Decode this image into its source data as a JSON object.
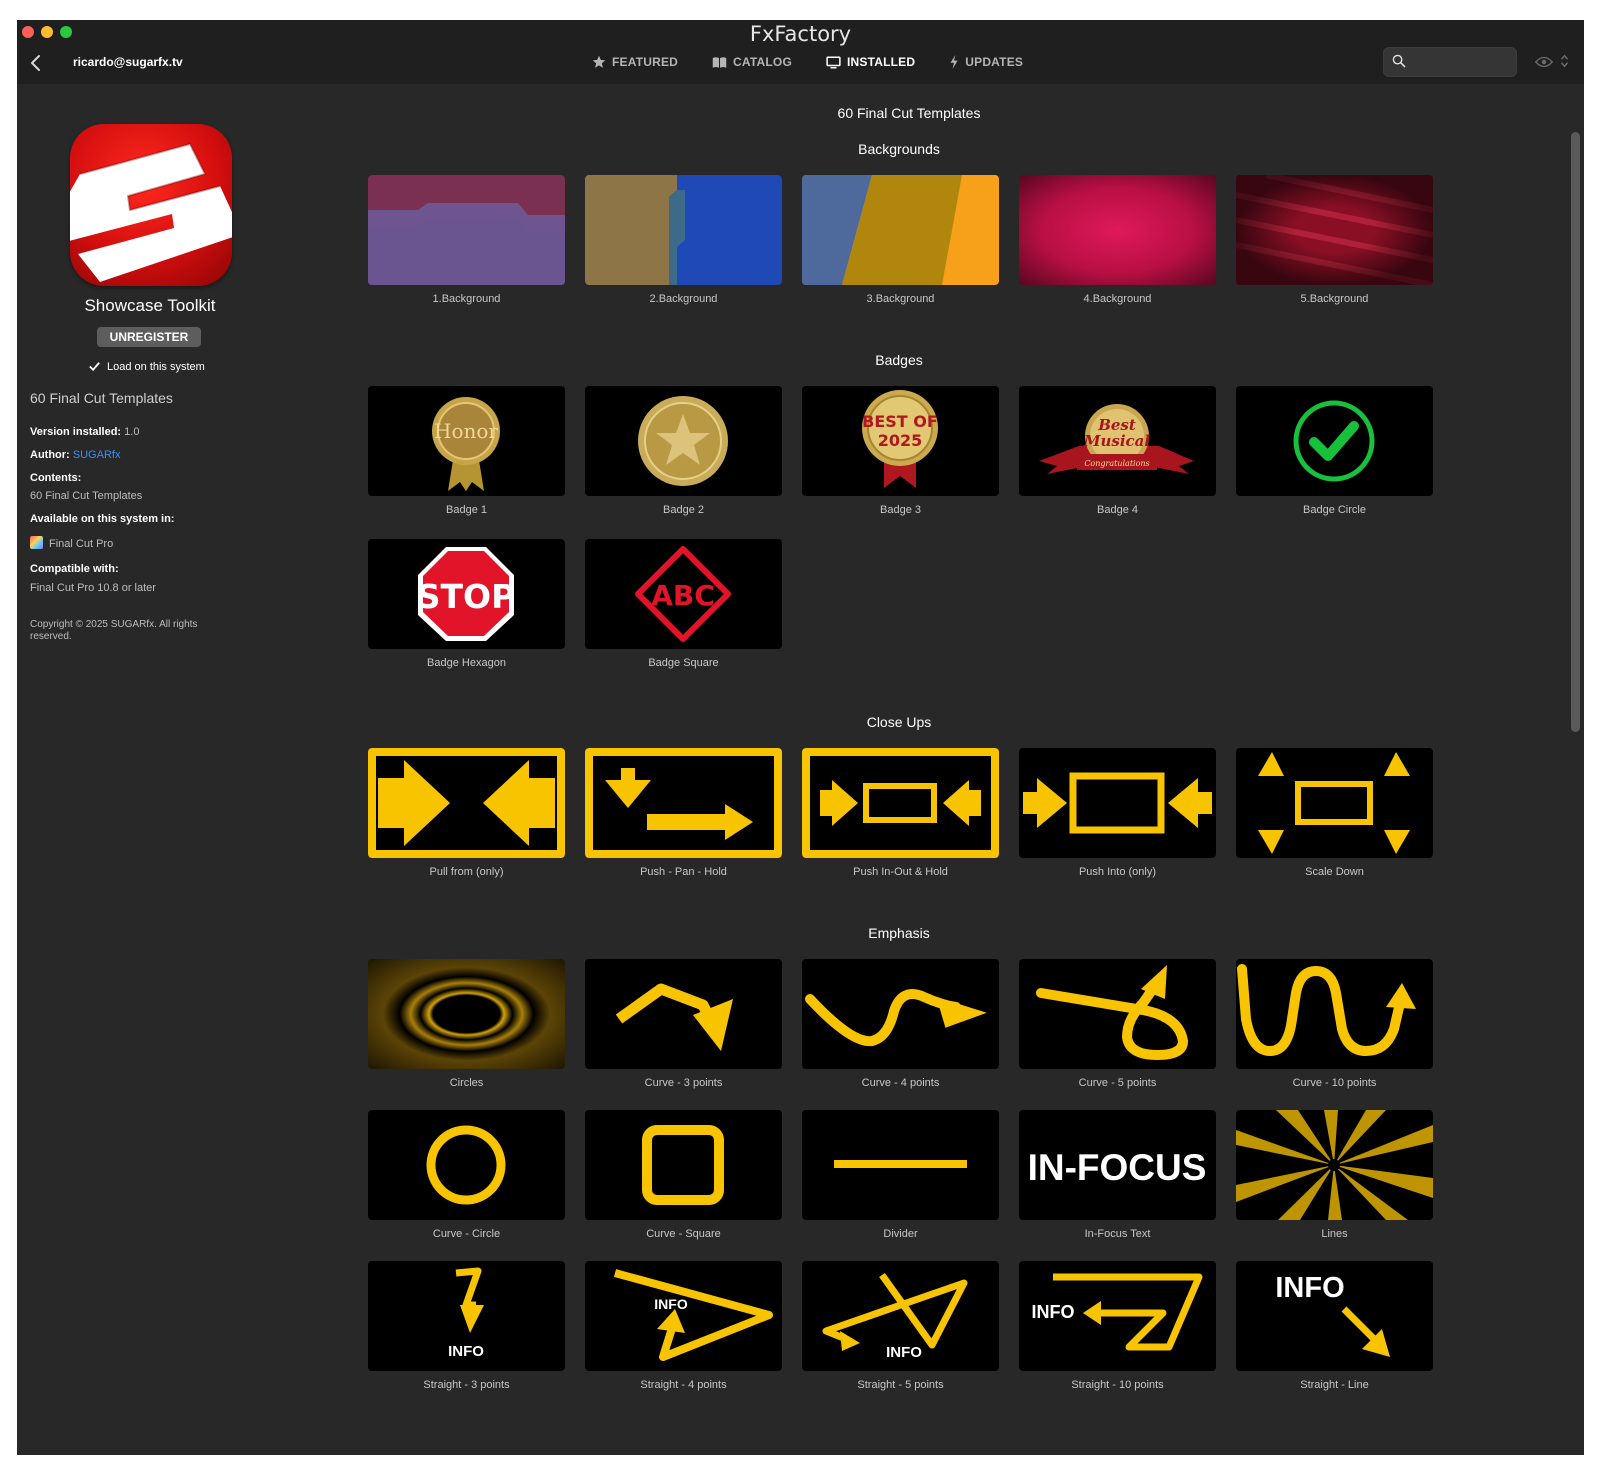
{
  "window": {
    "title": "FxFactory"
  },
  "header": {
    "account": "ricardo@sugarfx.tv",
    "tabs": [
      {
        "label": "FEATURED",
        "icon": "star-icon"
      },
      {
        "label": "CATALOG",
        "icon": "book-icon"
      },
      {
        "label": "INSTALLED",
        "icon": "monitor-icon",
        "active": true
      },
      {
        "label": "UPDATES",
        "icon": "bolt-icon"
      }
    ],
    "search": {
      "placeholder": "",
      "value": ""
    }
  },
  "sidebar": {
    "product_name": "Showcase Toolkit",
    "unregister_label": "UNREGISTER",
    "load_label": "Load on this system",
    "load_checked": true,
    "count": "60 Final Cut Templates",
    "version_label": "Version installed:",
    "version_value": "1.0",
    "author_label": "Author:",
    "author_value": "SUGARfx",
    "contents_label": "Contents:",
    "contents_value": "60 Final Cut Templates",
    "available_label": "Available on this system in:",
    "available_value": "Final Cut Pro",
    "compatible_label": "Compatible with:",
    "compatible_value": "Final Cut Pro 10.8 or later",
    "copyright": "Copyright © 2025 SUGARfx. All rights reserved."
  },
  "main": {
    "total": "60 Final Cut Templates",
    "sections": [
      {
        "title": "Backgrounds",
        "items": [
          "1.Background",
          "2.Background",
          "3.Background",
          "4.Background",
          "5.Background"
        ]
      },
      {
        "title": "Badges",
        "items": [
          "Badge 1",
          "Badge 2",
          "Badge 3",
          "Badge 4",
          "Badge Circle",
          "Badge Hexagon",
          "Badge Square"
        ]
      },
      {
        "title": "Close Ups",
        "items": [
          "Pull from (only)",
          "Push - Pan - Hold",
          "Push In-Out & Hold",
          "Push Into (only)",
          "Scale Down"
        ]
      },
      {
        "title": "Emphasis",
        "items": [
          "Circles",
          "Curve - 3 points",
          "Curve - 4 points",
          "Curve - 5 points",
          "Curve - 10 points",
          "Curve - Circle",
          "Curve - Square",
          "Divider",
          "In-Focus Text",
          "Lines",
          "Straight - 3 points",
          "Straight - 4 points",
          "Straight - 5 points",
          "Straight - 10 points",
          "Straight - Line"
        ]
      }
    ],
    "thumb_text": {
      "honor": "Honor",
      "best_of": "BEST OF",
      "year": "2025",
      "best": "Best",
      "musical": "Musical",
      "congrats": "Congratulations",
      "stop": "STOP",
      "abc": "ABC",
      "in_focus": "IN-FOCUS",
      "info": "INFO"
    }
  },
  "colors": {
    "accent_yellow": "#f8c400",
    "link_blue": "#3b8ef0",
    "window_bg": "#282828",
    "titlebar_bg": "#1f1f1f",
    "badge_green": "#17c13c",
    "stop_red": "#e1142a"
  }
}
